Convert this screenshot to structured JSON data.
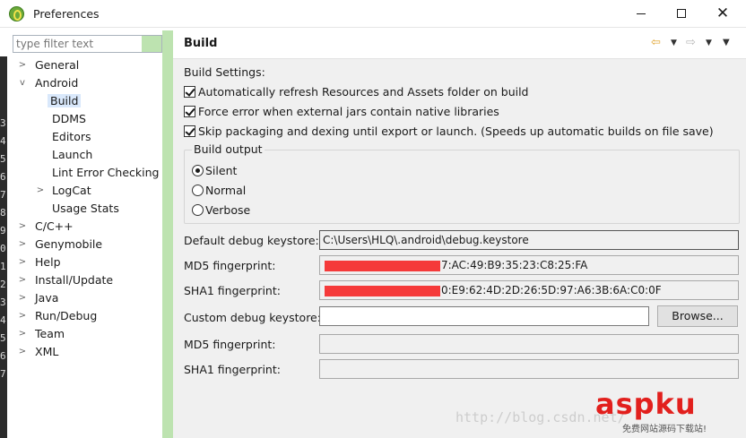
{
  "window": {
    "title": "Preferences"
  },
  "filter": {
    "placeholder": "type filter text"
  },
  "left_strip": [
    "3",
    "4",
    "5",
    "6",
    "7",
    "8",
    "9",
    "0",
    "1",
    "2",
    "3",
    "4",
    "5",
    "6",
    "7"
  ],
  "tree": [
    {
      "label": "General",
      "expander": "collapsed"
    },
    {
      "label": "Android",
      "expander": "expanded"
    },
    {
      "label": "Build",
      "selected": true
    },
    {
      "label": "DDMS"
    },
    {
      "label": "Editors"
    },
    {
      "label": "Launch"
    },
    {
      "label": "Lint Error Checking"
    },
    {
      "label": "LogCat",
      "expander": "collapsed"
    },
    {
      "label": "Usage Stats"
    },
    {
      "label": "C/C++",
      "expander": "collapsed"
    },
    {
      "label": "Genymobile",
      "expander": "collapsed"
    },
    {
      "label": "Help",
      "expander": "collapsed"
    },
    {
      "label": "Install/Update",
      "expander": "collapsed"
    },
    {
      "label": "Java",
      "expander": "collapsed"
    },
    {
      "label": "Run/Debug",
      "expander": "collapsed"
    },
    {
      "label": "Team",
      "expander": "collapsed"
    },
    {
      "label": "XML",
      "expander": "collapsed"
    }
  ],
  "page": {
    "title": "Build",
    "settings_label": "Build Settings:",
    "checkboxes": [
      {
        "label": "Automatically refresh Resources and Assets folder on build",
        "checked": true
      },
      {
        "label": "Force error when external jars contain native libraries",
        "checked": true
      },
      {
        "label": "Skip packaging and dexing until export or launch. (Speeds up automatic builds on file save)",
        "checked": true
      }
    ],
    "build_output": {
      "title": "Build output",
      "options": [
        {
          "label": "Silent",
          "selected": true
        },
        {
          "label": "Normal",
          "selected": false
        },
        {
          "label": "Verbose",
          "selected": false
        }
      ]
    },
    "default_keystore_label": "Default debug keystore:",
    "default_keystore_value": "C:\\Users\\HLQ\\.android\\debug.keystore",
    "md5_label": "MD5 fingerprint:",
    "md5_value": "7:AC:49:B9:35:23:C8:25:FA",
    "sha1_label": "SHA1 fingerprint:",
    "sha1_value": "0:E9:62:4D:2D:26:5D:97:A6:3B:6A:C0:0F",
    "custom_keystore_label": "Custom debug keystore:",
    "custom_keystore_value": "",
    "browse_label": "Browse...",
    "custom_md5_label": "MD5 fingerprint:",
    "custom_sha1_label": "SHA1 fingerprint:"
  },
  "watermark": {
    "url": "http://blog.csdn.net/",
    "brand": "aspku",
    "brand_sub": "免费网站源码下载站!"
  },
  "colors": {
    "selection": "#d9e8fb",
    "sash": "#bde3b0",
    "redaction": "#f53a3a",
    "brand": "#e2201d"
  },
  "icons": [
    "app-icon",
    "minimize-icon",
    "maximize-icon",
    "close-icon",
    "back-arrow-icon",
    "forward-arrow-icon",
    "view-menu-icon"
  ]
}
